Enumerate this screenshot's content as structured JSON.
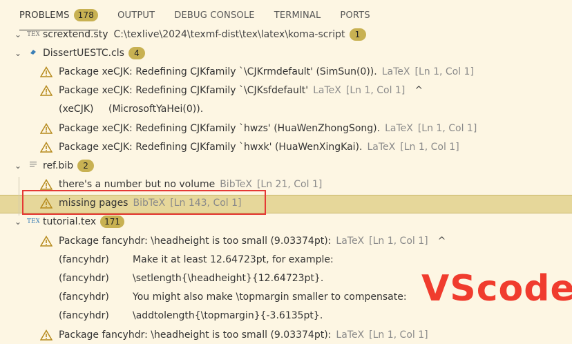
{
  "tabs": [
    {
      "label": "PROBLEMS",
      "badge": "178"
    },
    {
      "label": "OUTPUT"
    },
    {
      "label": "DEBUG CONSOLE"
    },
    {
      "label": "TERMINAL"
    },
    {
      "label": "PORTS"
    }
  ],
  "files": {
    "scrextend": {
      "name": "scrextend.sty",
      "path": "C:\\texlive\\2024\\texmf-dist\\tex\\latex\\koma-script",
      "count": "1"
    },
    "dissert": {
      "name": "DissertUESTC.cls",
      "count": "4"
    },
    "refbib": {
      "name": "ref.bib",
      "count": "2"
    },
    "tutorial": {
      "name": "tutorial.tex",
      "count": "171"
    }
  },
  "problems": {
    "d1": {
      "msg": "Package xeCJK: Redefining CJKfamily `\\CJKrmdefault' (SimSun(0)).",
      "src": "LaTeX",
      "loc": "[Ln 1, Col 1]"
    },
    "d2": {
      "msg": "Package xeCJK: Redefining CJKfamily `\\CJKsfdefault'",
      "src": "LaTeX",
      "loc": "[Ln 1, Col 1]",
      "cont_a": "(xeCJK)",
      "cont_b": "(MicrosoftYaHei(0))."
    },
    "d3": {
      "msg": "Package xeCJK: Redefining CJKfamily `hwzs' (HuaWenZhongSong).",
      "src": "LaTeX",
      "loc": "[Ln 1, Col 1]"
    },
    "d4": {
      "msg": "Package xeCJK: Redefining CJKfamily `hwxk' (HuaWenXingKai).",
      "src": "LaTeX",
      "loc": "[Ln 1, Col 1]"
    },
    "r1": {
      "msg": "there's a number but no volume",
      "src": "BibTeX",
      "loc": "[Ln 21, Col 1]"
    },
    "r2": {
      "msg": "missing pages",
      "src": "BibTeX",
      "loc": "[Ln 143, Col 1]"
    },
    "t1": {
      "msg": "Package fancyhdr: \\headheight is too small (9.03374pt):",
      "src": "LaTeX",
      "loc": "[Ln 1, Col 1]"
    },
    "t1_lines": [
      {
        "a": "(fancyhdr)",
        "b": "Make it at least 12.64723pt, for example:"
      },
      {
        "a": "(fancyhdr)",
        "b": "\\setlength{\\headheight}{12.64723pt}."
      },
      {
        "a": "(fancyhdr)",
        "b": "You might also make \\topmargin smaller to compensate:"
      },
      {
        "a": "(fancyhdr)",
        "b": "\\addtolength{\\topmargin}{-3.6135pt}."
      }
    ],
    "t2": {
      "msg": "Package fancyhdr: \\headheight is too small (9.03374pt):",
      "src": "LaTeX",
      "loc": "[Ln 1, Col 1]"
    }
  },
  "watermark": "VScode"
}
